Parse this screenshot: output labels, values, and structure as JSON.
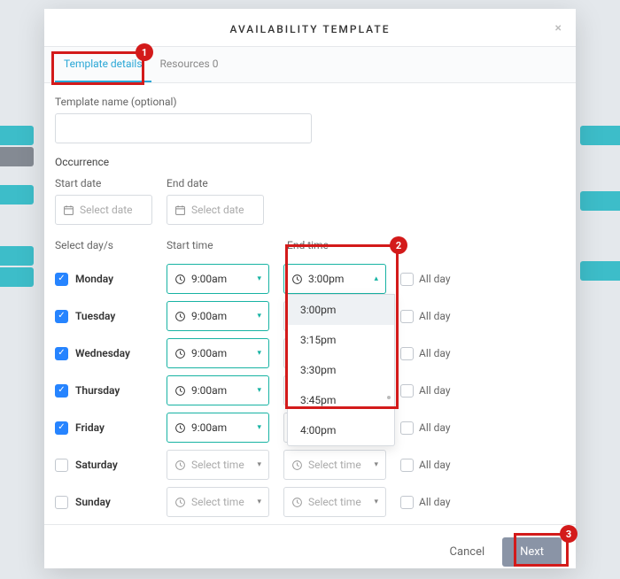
{
  "modal": {
    "title": "AVAILABILITY TEMPLATE",
    "tabs": {
      "details": "Template details",
      "resources": "Resources 0"
    },
    "template_name_label": "Template name (optional)",
    "occurrence_label": "Occurrence",
    "start_date_label": "Start date",
    "end_date_label": "End date",
    "select_date_placeholder": "Select date",
    "select_days_label": "Select day/s",
    "start_time_label": "Start time",
    "end_time_label": "End time",
    "select_time_placeholder": "Select time",
    "all_day_label": "All day",
    "days": [
      {
        "name": "Monday",
        "checked": true,
        "start": "9:00am",
        "end": "3:00pm",
        "end_open": true
      },
      {
        "name": "Tuesday",
        "checked": true,
        "start": "9:00am",
        "end": ""
      },
      {
        "name": "Wednesday",
        "checked": true,
        "start": "9:00am",
        "end": ""
      },
      {
        "name": "Thursday",
        "checked": true,
        "start": "9:00am",
        "end": ""
      },
      {
        "name": "Friday",
        "checked": true,
        "start": "9:00am",
        "end": ""
      },
      {
        "name": "Saturday",
        "checked": false,
        "start": "",
        "end": ""
      },
      {
        "name": "Sunday",
        "checked": false,
        "start": "",
        "end": ""
      }
    ],
    "dropdown_options": [
      "3:00pm",
      "3:15pm",
      "3:30pm",
      "3:45pm",
      "4:00pm"
    ],
    "cancel_label": "Cancel",
    "next_label": "Next"
  },
  "annotations": {
    "b1": "1",
    "b2": "2",
    "b3": "3"
  }
}
